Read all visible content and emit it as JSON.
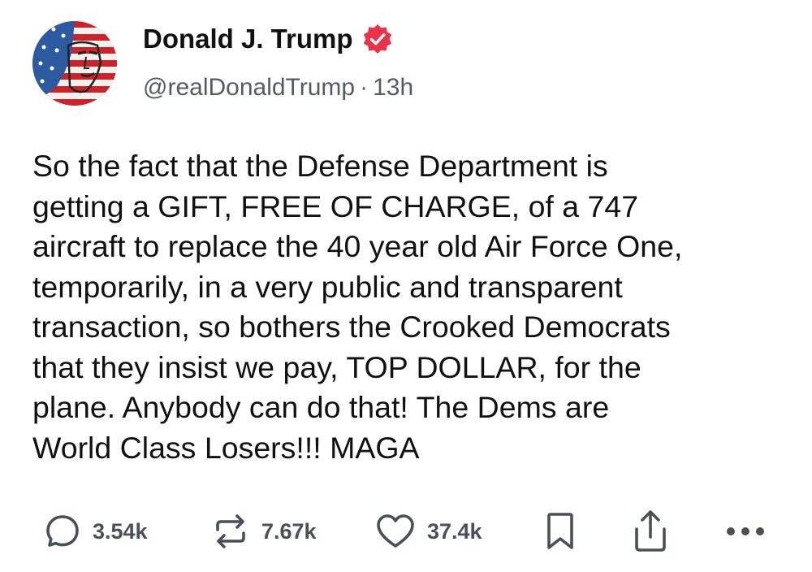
{
  "post": {
    "author": {
      "name": "Donald J. Trump",
      "handle": "@realDonaldTrump",
      "verified": true,
      "avatar": "flag-painted-portrait"
    },
    "separator": "·",
    "time_ago": "13h",
    "text": "So the fact that the Defense Department is\ngetting a GIFT, FREE OF CHARGE, of a 747\naircraft to replace the 40 year old Air Force One,\ntemporarily, in a very public and transparent\ntransaction, so bothers the Crooked Democrats\nthat they insist we pay, TOP DOLLAR, for the\nplane. Anybody can do that! The Dems are\nWorld Class Losers!!! MAGA"
  },
  "actions": {
    "replies": "3.54k",
    "reposts": "7.67k",
    "likes": "37.4k",
    "bookmark_icon": "bookmark-icon",
    "share_icon": "share-icon",
    "more_icon": "more-icon"
  },
  "colors": {
    "verified_badge": "#e8334a",
    "icon_gray": "#4a5058",
    "text": "#111111",
    "secondary_text": "#555b63"
  }
}
